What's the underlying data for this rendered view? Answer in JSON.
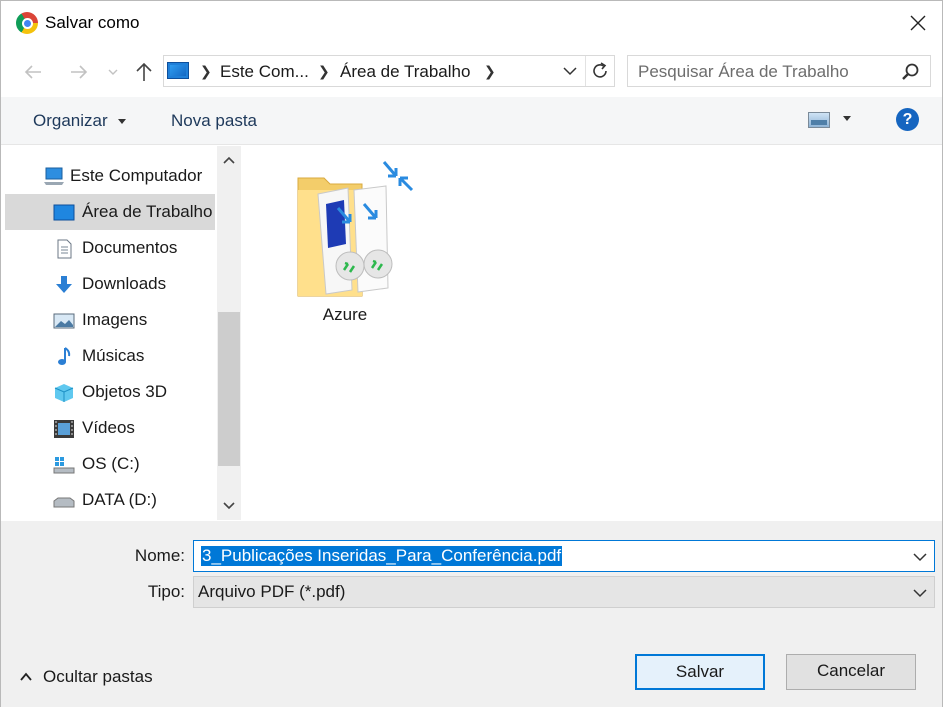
{
  "window": {
    "title": "Salvar como",
    "icon": "chrome-icon"
  },
  "navigation": {
    "breadcrumb": [
      "Este Com...",
      "Área de Trabalho"
    ],
    "search_placeholder": "Pesquisar Área de Trabalho"
  },
  "toolbar": {
    "organize_label": "Organizar",
    "new_folder_label": "Nova pasta",
    "help_label": "?"
  },
  "sidebar": {
    "items": [
      {
        "label": "Este Computador",
        "icon": "computer-icon",
        "selected": false
      },
      {
        "label": "Área de Trabalho",
        "icon": "desktop-icon",
        "selected": true
      },
      {
        "label": "Documentos",
        "icon": "documents-icon",
        "selected": false
      },
      {
        "label": "Downloads",
        "icon": "downloads-icon",
        "selected": false
      },
      {
        "label": "Imagens",
        "icon": "pictures-icon",
        "selected": false
      },
      {
        "label": "Músicas",
        "icon": "music-icon",
        "selected": false
      },
      {
        "label": "Objetos 3D",
        "icon": "objects-3d-icon",
        "selected": false
      },
      {
        "label": "Vídeos",
        "icon": "videos-icon",
        "selected": false
      },
      {
        "label": "OS (C:)",
        "icon": "drive-c-icon",
        "selected": false
      },
      {
        "label": "DATA (D:)",
        "icon": "drive-d-icon",
        "selected": false
      }
    ]
  },
  "content": {
    "items": [
      {
        "label": "Azure",
        "icon": "remote-desktop-folder-icon"
      }
    ]
  },
  "form": {
    "name_label": "Nome:",
    "name_value": "3_Publicações Inseridas_Para_Conferência.pdf",
    "type_label": "Tipo:",
    "type_value": "Arquivo PDF (*.pdf)"
  },
  "footer": {
    "hide_folders_label": "Ocultar pastas",
    "save_label": "Salvar",
    "cancel_label": "Cancelar"
  },
  "colors": {
    "accent": "#0078d7",
    "selection_bg": "#d9d9d9",
    "help_blue": "#1565c0"
  }
}
